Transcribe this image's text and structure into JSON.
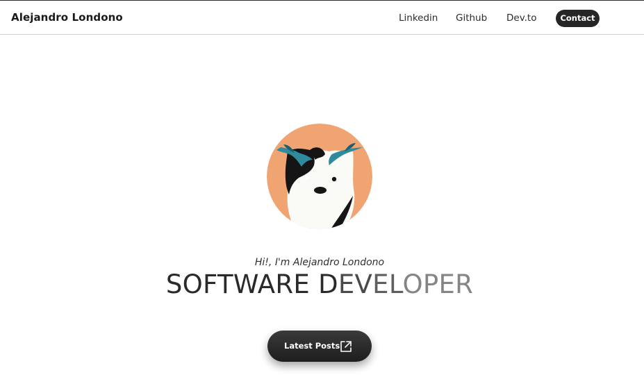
{
  "header": {
    "brand": "Alejandro Londono",
    "nav": {
      "linkedin": "Linkedin",
      "github": "Github",
      "devto": "Dev.to",
      "contact": "Contact"
    }
  },
  "hero": {
    "avatar_icon": "raccoon-avatar",
    "greeting": "Hi!, I'm Alejandro Londono",
    "headline_parts": [
      "SOFTWARE D",
      "EV",
      "EL",
      "OPER"
    ],
    "headline_colors": [
      "#2a2a2a",
      "#4a4a4a",
      "#5f5f5f",
      "#858585"
    ],
    "cta_label": "Latest Posts",
    "cta_icon": "external-link-icon"
  },
  "colors": {
    "avatar_bg": "#EFA472",
    "accent_teal": "#2E8A9C",
    "dark": "#262626"
  }
}
